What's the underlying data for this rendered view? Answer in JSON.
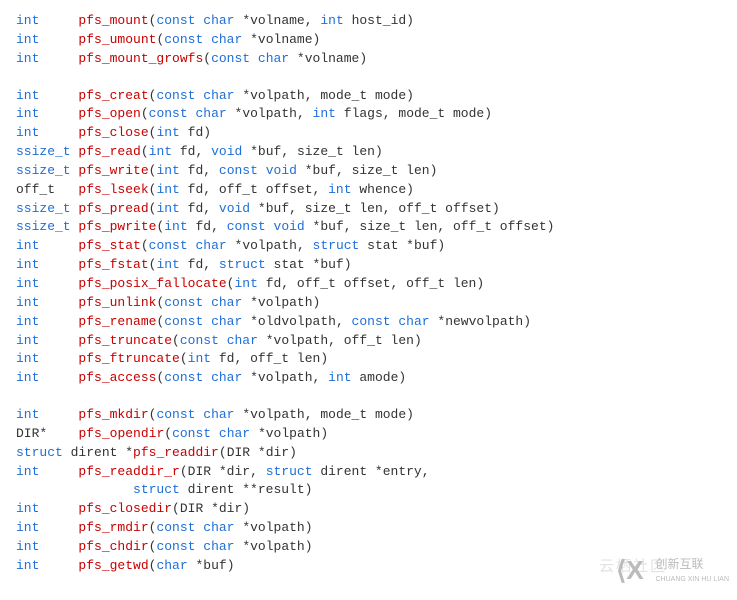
{
  "lines": [
    {
      "ret": "int    ",
      "fn": "pfs_mount",
      "params": [
        [
          "const",
          "char",
          "*volname"
        ],
        [
          "",
          "int",
          "host_id"
        ]
      ]
    },
    {
      "ret": "int    ",
      "fn": "pfs_umount",
      "params": [
        [
          "const",
          "char",
          "*volname"
        ]
      ]
    },
    {
      "ret": "int    ",
      "fn": "pfs_mount_growfs",
      "params": [
        [
          "const",
          "char",
          "*volname"
        ]
      ]
    },
    null,
    {
      "ret": "int    ",
      "fn": "pfs_creat",
      "params": [
        [
          "const",
          "char",
          "*volpath"
        ],
        [
          "",
          "",
          "mode_t mode"
        ]
      ]
    },
    {
      "ret": "int    ",
      "fn": "pfs_open",
      "params": [
        [
          "const",
          "char",
          "*volpath"
        ],
        [
          "",
          "int",
          "flags"
        ],
        [
          "",
          "",
          "mode_t mode"
        ]
      ]
    },
    {
      "ret": "int    ",
      "fn": "pfs_close",
      "params": [
        [
          "",
          "int",
          "fd"
        ]
      ]
    },
    {
      "ret": "ssize_t",
      "fn": "pfs_read",
      "params": [
        [
          "",
          "int",
          "fd"
        ],
        [
          "",
          "void",
          "*buf"
        ],
        [
          "",
          "",
          "size_t len"
        ]
      ]
    },
    {
      "ret": "ssize_t",
      "fn": "pfs_write",
      "params": [
        [
          "",
          "int",
          "fd"
        ],
        [
          "const",
          "void",
          "*buf"
        ],
        [
          "",
          "",
          "size_t len"
        ]
      ]
    },
    {
      "ret": "off_t  ",
      "fn": "pfs_lseek",
      "params": [
        [
          "",
          "int",
          "fd"
        ],
        [
          "",
          "",
          "off_t offset"
        ],
        [
          "",
          "int",
          "whence"
        ]
      ]
    },
    {
      "ret": "ssize_t",
      "fn": "pfs_pread",
      "params": [
        [
          "",
          "int",
          "fd"
        ],
        [
          "",
          "void",
          "*buf"
        ],
        [
          "",
          "",
          "size_t len"
        ],
        [
          "",
          "",
          "off_t offset"
        ]
      ]
    },
    {
      "ret": "ssize_t",
      "fn": "pfs_pwrite",
      "params": [
        [
          "",
          "int",
          "fd"
        ],
        [
          "const",
          "void",
          "*buf"
        ],
        [
          "",
          "",
          "size_t len"
        ],
        [
          "",
          "",
          "off_t offset"
        ]
      ]
    },
    {
      "ret": "int    ",
      "fn": "pfs_stat",
      "params": [
        [
          "const",
          "char",
          "*volpath"
        ],
        [
          "",
          "struct",
          "stat *buf"
        ]
      ]
    },
    {
      "ret": "int    ",
      "fn": "pfs_fstat",
      "params": [
        [
          "",
          "int",
          "fd"
        ],
        [
          "",
          "struct",
          "stat *buf"
        ]
      ]
    },
    {
      "ret": "int    ",
      "fn": "pfs_posix_fallocate",
      "params": [
        [
          "",
          "int",
          "fd"
        ],
        [
          "",
          "",
          "off_t offset"
        ],
        [
          "",
          "",
          "off_t len"
        ]
      ]
    },
    {
      "ret": "int    ",
      "fn": "pfs_unlink",
      "params": [
        [
          "const",
          "char",
          "*volpath"
        ]
      ]
    },
    {
      "ret": "int    ",
      "fn": "pfs_rename",
      "params": [
        [
          "const",
          "char",
          "*oldvolpath"
        ],
        [
          "const",
          "char",
          "*newvolpath"
        ]
      ]
    },
    {
      "ret": "int    ",
      "fn": "pfs_truncate",
      "params": [
        [
          "const",
          "char",
          "*volpath"
        ],
        [
          "",
          "",
          "off_t len"
        ]
      ]
    },
    {
      "ret": "int    ",
      "fn": "pfs_ftruncate",
      "params": [
        [
          "",
          "int",
          "fd"
        ],
        [
          "",
          "",
          "off_t len"
        ]
      ]
    },
    {
      "ret": "int    ",
      "fn": "pfs_access",
      "params": [
        [
          "const",
          "char",
          "*volpath"
        ],
        [
          "",
          "int",
          "amode"
        ]
      ]
    },
    null,
    {
      "ret": "int    ",
      "fn": "pfs_mkdir",
      "params": [
        [
          "const",
          "char",
          "*volpath"
        ],
        [
          "",
          "",
          "mode_t mode"
        ]
      ]
    },
    {
      "ret": "DIR*   ",
      "fn": "pfs_opendir",
      "params": [
        [
          "const",
          "char",
          "*volpath"
        ]
      ]
    },
    {
      "ret": "struct ",
      "ret2": "dirent *",
      "fn": "pfs_readdir",
      "params": [
        [
          "",
          "",
          "DIR *dir"
        ]
      ]
    },
    {
      "ret": "int    ",
      "fn": "pfs_readdir_r",
      "params": [
        [
          "",
          "",
          "DIR *dir"
        ],
        [
          "",
          "struct",
          "dirent *entry"
        ]
      ],
      "cont": true
    },
    {
      "cont_line": true,
      "text": "               struct dirent **result)"
    },
    {
      "ret": "int    ",
      "fn": "pfs_closedir",
      "params": [
        [
          "",
          "",
          "DIR *dir"
        ]
      ]
    },
    {
      "ret": "int    ",
      "fn": "pfs_rmdir",
      "params": [
        [
          "const",
          "char",
          "*volpath"
        ]
      ]
    },
    {
      "ret": "int    ",
      "fn": "pfs_chdir",
      "params": [
        [
          "const",
          "char",
          "*volpath"
        ]
      ]
    },
    {
      "ret": "int    ",
      "fn": "pfs_getwd",
      "params": [
        [
          "",
          "char",
          "*buf"
        ]
      ]
    }
  ],
  "watermark_faint": "云栖社区",
  "watermark_brand": "创新互联",
  "watermark_pinyin": "CHUANG XIN HU LIAN"
}
